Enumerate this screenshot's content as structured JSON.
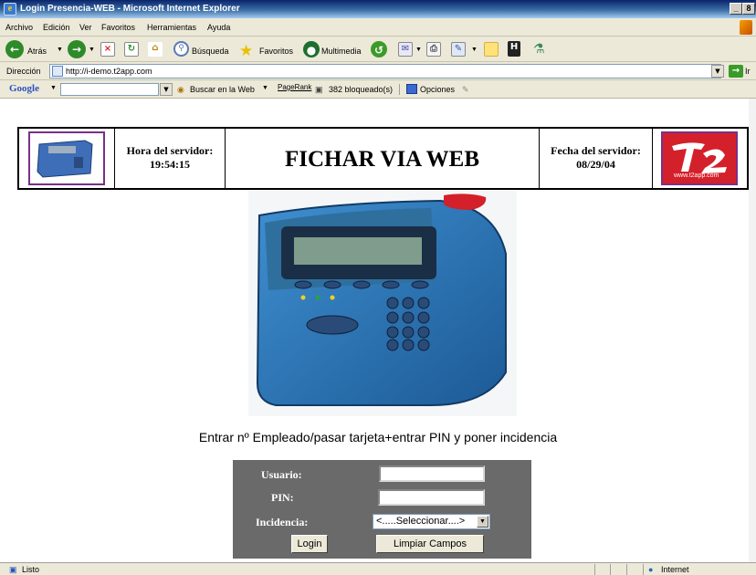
{
  "window": {
    "title": "Login Presencia-WEB - Microsoft Internet Explorer",
    "minimize": "_",
    "maximize": "8"
  },
  "menu": [
    "Archivo",
    "Edición",
    "Ver",
    "Favoritos",
    "Herramientas",
    "Ayuda"
  ],
  "toolbar": {
    "back": "Atrás",
    "search": "Búsqueda",
    "favorites": "Favoritos",
    "multimedia": "Multimedia"
  },
  "address": {
    "label": "Dirección",
    "url": "http://i-demo.t2app.com",
    "go": "Ir"
  },
  "google_bar": {
    "logo": "Google",
    "search_web": "Buscar en la Web",
    "pagerank": "PageRank",
    "blocked": "382 bloqueado(s)",
    "options": "Opciones"
  },
  "header": {
    "server_time_label": "Hora del servidor:",
    "server_time": "19:54:15",
    "title": "FICHAR VIA WEB",
    "server_date_label": "Fecha del servidor:",
    "server_date": "08/29/04",
    "logo_url": "www.t2app.com"
  },
  "instructions": "Entrar nº Empleado/pasar tarjeta+entrar PIN y poner incidencia",
  "form": {
    "user_label": "Usuario:",
    "pin_label": "PIN:",
    "incident_label": "Incidencia:",
    "incident_selected": "<.....Seleccionar....>",
    "login_button": "Login",
    "clear_button": "Limpiar Campos"
  },
  "status": {
    "text": "Listo",
    "zone": "Internet"
  }
}
